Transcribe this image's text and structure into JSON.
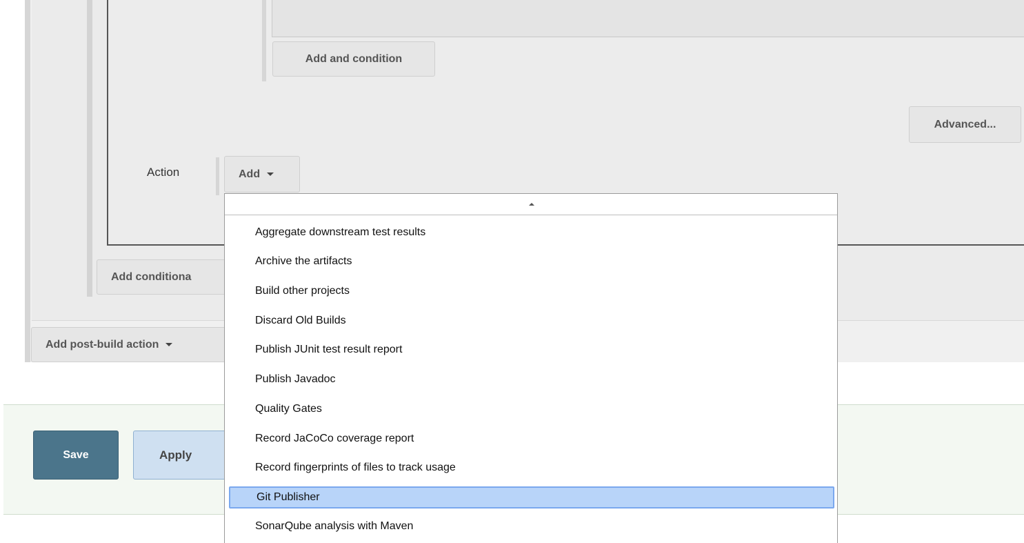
{
  "condition": {
    "add_and_label": "Add and condition",
    "advanced_label": "Advanced..."
  },
  "action": {
    "label": "Action",
    "add_label": "Add"
  },
  "add_conditional_label": "Add conditiona",
  "post_build": {
    "label": "Add post-build action"
  },
  "footer": {
    "save_label": "Save",
    "apply_label": "Apply"
  },
  "menu": {
    "items": [
      {
        "label": "Aggregate downstream test results",
        "selected": false
      },
      {
        "label": "Archive the artifacts",
        "selected": false
      },
      {
        "label": "Build other projects",
        "selected": false
      },
      {
        "label": "Discard Old Builds",
        "selected": false
      },
      {
        "label": "Publish JUnit test result report",
        "selected": false
      },
      {
        "label": "Publish Javadoc",
        "selected": false
      },
      {
        "label": "Quality Gates",
        "selected": false
      },
      {
        "label": "Record JaCoCo coverage report",
        "selected": false
      },
      {
        "label": "Record fingerprints of files to track usage",
        "selected": false
      },
      {
        "label": "Git Publisher",
        "selected": true
      },
      {
        "label": "SonarQube analysis with Maven",
        "selected": false
      }
    ]
  }
}
